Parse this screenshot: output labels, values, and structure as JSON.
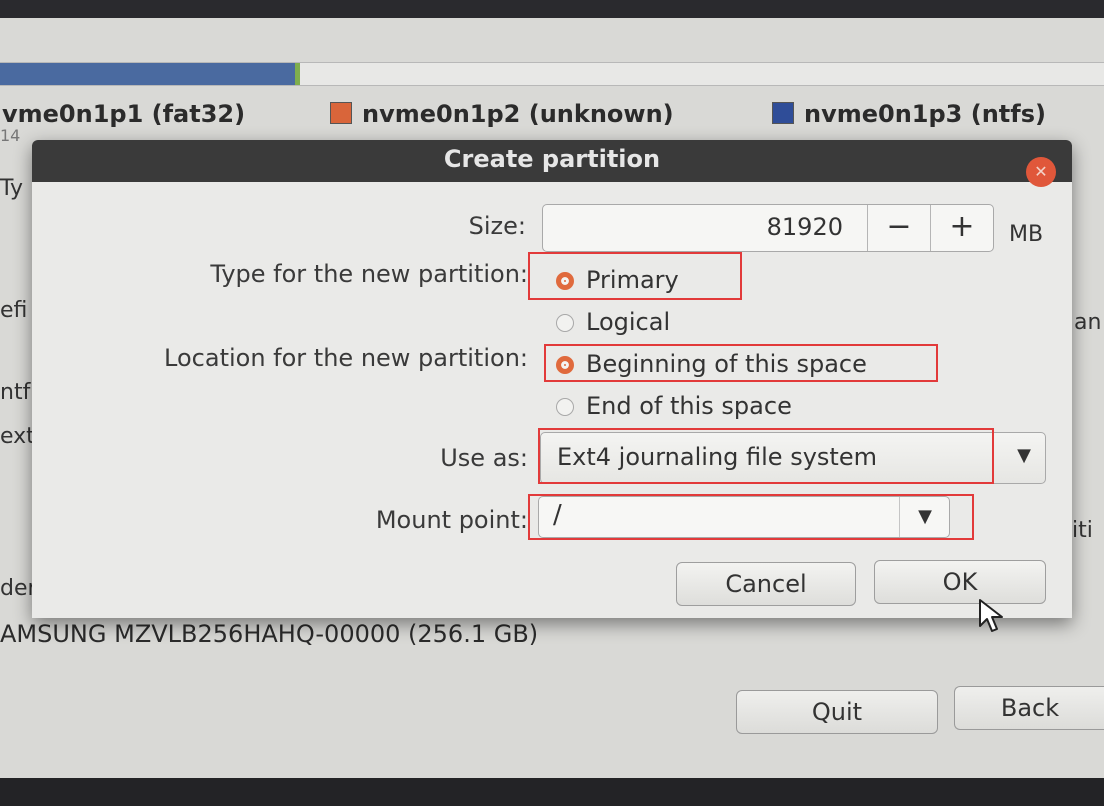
{
  "background": {
    "legend": [
      {
        "label": "vme0n1p1 (fat32)",
        "color": ""
      },
      {
        "label": "nvme0n1p2 (unknown)",
        "color": "#d9653a"
      },
      {
        "label": "nvme0n1p3 (ntfs)",
        "color": "#2f4d98"
      }
    ],
    "disk_label": "AMSUNG MZVLB256HAHQ-00000 (256.1 GB)",
    "quit_label": "Quit",
    "back_label": "Back",
    "fragments": {
      "f1": "14",
      "f2": "Ty",
      "f3": "efi",
      "f4": "ntf",
      "f5": "ext",
      "f6": "der",
      "f7": "an",
      "f8": "iti"
    }
  },
  "dialog": {
    "title": "Create partition",
    "size_label": "Size:",
    "size_value": "81920",
    "size_unit": "MB",
    "minus": "−",
    "plus": "+",
    "type_label": "Type for the new partition:",
    "type_options": [
      {
        "label": "Primary",
        "selected": true
      },
      {
        "label": "Logical",
        "selected": false
      }
    ],
    "location_label": "Location for the new partition:",
    "location_options": [
      {
        "label": "Beginning of this space",
        "selected": true
      },
      {
        "label": "End of this space",
        "selected": false
      }
    ],
    "use_as_label": "Use as:",
    "use_as_value": "Ext4 journaling file system",
    "mount_label": "Mount point:",
    "mount_value": "/",
    "cancel_label": "Cancel",
    "ok_label": "OK",
    "close_icon": "✕"
  },
  "colors": {
    "accent_radio": "#e06a3d",
    "highlight_box": "#e23a3a",
    "titlebar": "#3a3a3a"
  }
}
